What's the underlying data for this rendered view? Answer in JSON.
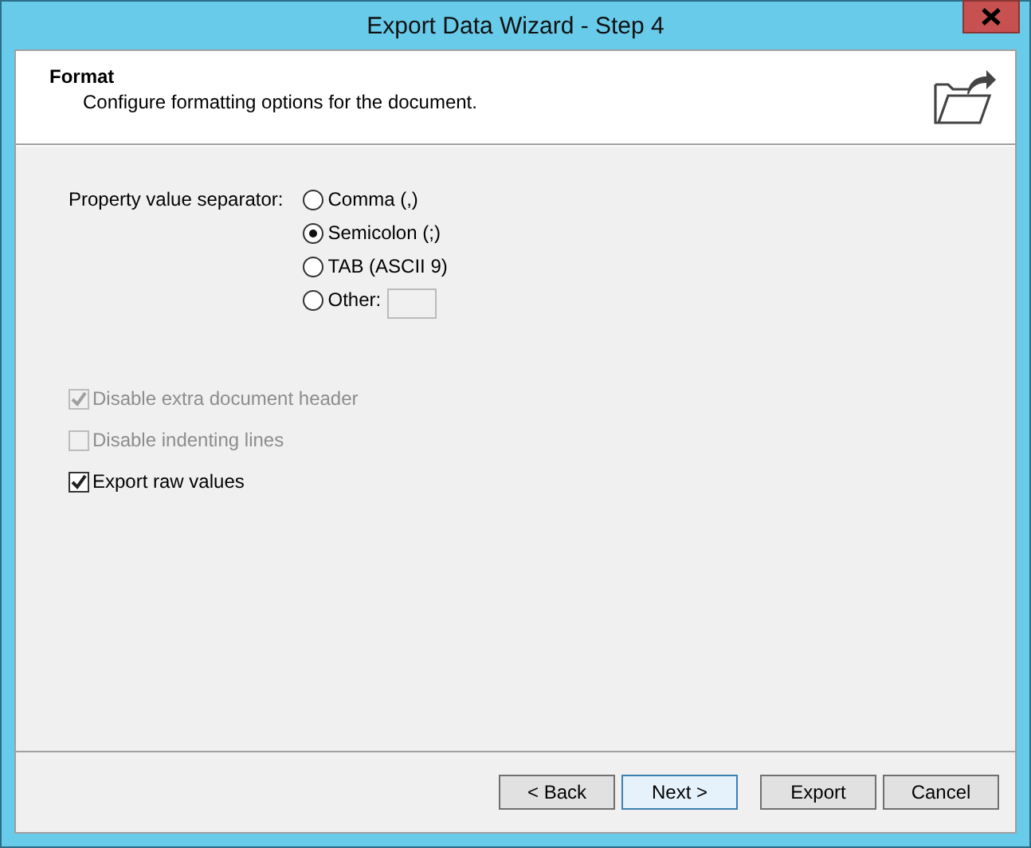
{
  "window": {
    "title": "Export Data Wizard - Step 4"
  },
  "header": {
    "title": "Format",
    "subtitle": "Configure formatting options for the document."
  },
  "separator": {
    "label": "Property value separator:",
    "options": [
      {
        "label": "Comma (,)",
        "selected": false,
        "kind": "plain"
      },
      {
        "label": "Semicolon (;)",
        "selected": true,
        "kind": "plain"
      },
      {
        "label": "TAB (ASCII 9)",
        "selected": false,
        "kind": "plain"
      },
      {
        "label": "Other:",
        "selected": false,
        "kind": "with_field"
      }
    ]
  },
  "checkboxes": [
    {
      "label": "Disable extra document header",
      "checked": true,
      "disabled": true
    },
    {
      "label": "Disable indenting lines",
      "checked": false,
      "disabled": true
    },
    {
      "label": "Export raw values",
      "checked": true,
      "disabled": false
    }
  ],
  "buttons": [
    {
      "label": "< Back",
      "focused": false
    },
    {
      "label": "Next >",
      "focused": true
    },
    {
      "label": "Export",
      "focused": false
    },
    {
      "label": "Cancel",
      "focused": false
    }
  ]
}
